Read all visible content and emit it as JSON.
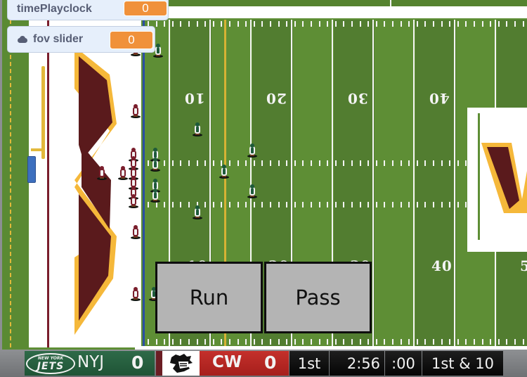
{
  "monitors": {
    "play_clock": {
      "label": "timePlayclock",
      "value": "0"
    },
    "fov_slider": {
      "label": "fov slider",
      "value": "0",
      "icon": "cloud-icon"
    }
  },
  "field": {
    "yard_numbers_top": [
      "10",
      "20",
      "30",
      "40"
    ],
    "yard_numbers_bottom": [
      "10",
      "20",
      "30",
      "40",
      "5"
    ],
    "colors": {
      "grass_light": "#5e8e35",
      "grass_dark": "#527d30",
      "first_down_line": "#d6b234",
      "line_of_scrimmage": "#2b4fa3",
      "home_primary": "#5a1a1c",
      "home_secondary": "#f5b83a"
    }
  },
  "play_buttons": {
    "run": "Run",
    "pass": "Pass"
  },
  "scoreboard": {
    "away": {
      "logo_top": "NEW YORK",
      "logo_main": "JETS",
      "abbr": "NYJ",
      "score": "0",
      "color": "#2b6545"
    },
    "home": {
      "abbr": "CW",
      "score": "0",
      "color": "#b52622"
    },
    "quarter": "1st",
    "game_clock": "2:56",
    "play_clock": ":00",
    "down_distance": "1st & 10"
  }
}
